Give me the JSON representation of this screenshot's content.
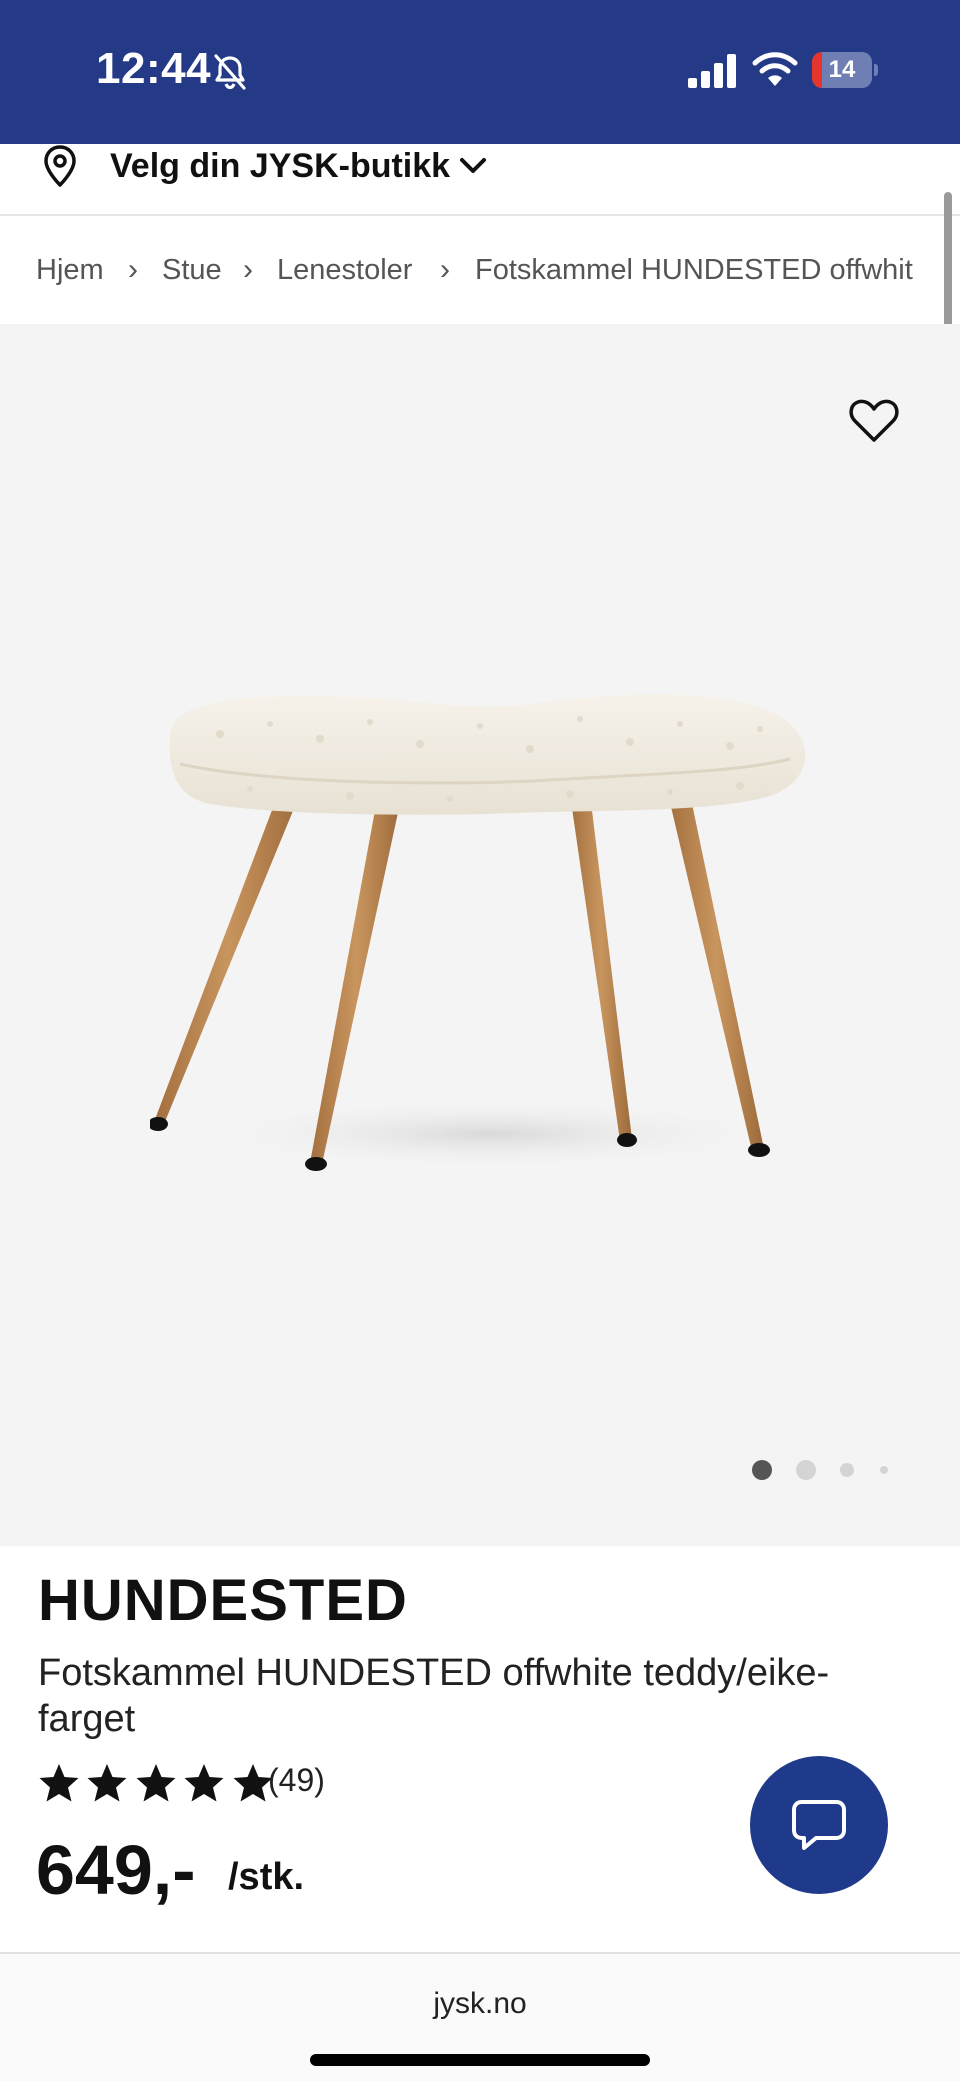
{
  "status_bar": {
    "time": "12:44",
    "battery_level": "14",
    "icons": [
      "bell-slash-icon",
      "signal-icon",
      "wifi-icon",
      "battery-icon"
    ],
    "background_color": "#253a87"
  },
  "store_selector": {
    "label": "Velg din JYSK-butikk",
    "icon": "map-pin-icon"
  },
  "breadcrumb": {
    "items": [
      "Hjem",
      "Stue",
      "Lenestoler",
      "Fotskammel HUNDESTED offwhit"
    ],
    "separator": "›"
  },
  "gallery": {
    "image_alt": "Fotskammel HUNDESTED",
    "favorite_icon": "heart-outline-icon",
    "slide_count": 4,
    "active_slide": 1
  },
  "product": {
    "brand": "HUNDESTED",
    "name": "Fotskammel HUNDESTED offwhite teddy/eike-farget",
    "rating_stars": 5,
    "review_count": "(49)",
    "price": "649,-",
    "price_unit": "/stk."
  },
  "chat": {
    "icon": "chat-bubble-icon",
    "color": "#1f3a8a"
  },
  "browser": {
    "url": "jysk.no"
  }
}
